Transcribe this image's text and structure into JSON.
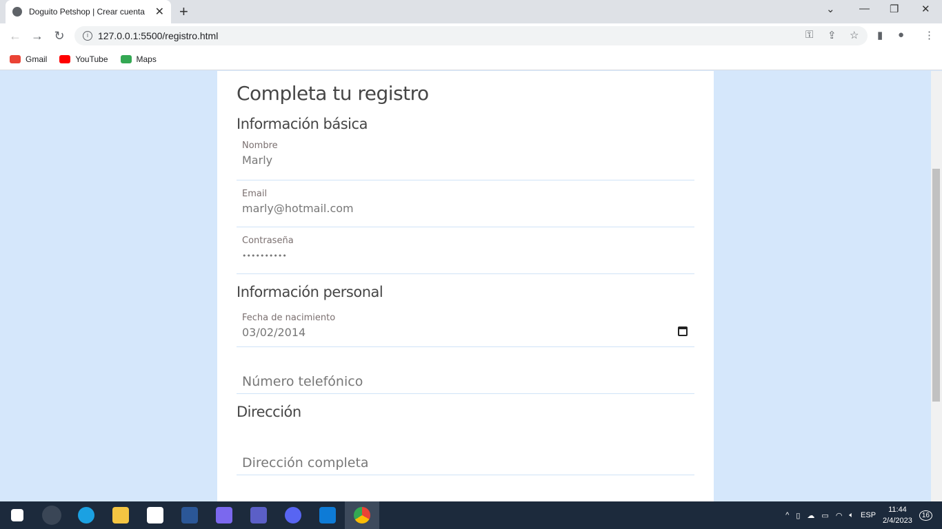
{
  "browser": {
    "tab_title": "Doguito Petshop | Crear cuenta",
    "url": "127.0.0.1:5500/registro.html",
    "bookmarks": [
      {
        "label": "Gmail",
        "color": "#ea4335"
      },
      {
        "label": "YouTube",
        "color": "#ff0000"
      },
      {
        "label": "Maps",
        "color": "#34a853"
      }
    ]
  },
  "form": {
    "title": "Completa tu registro",
    "sections": {
      "basic": "Información básica",
      "personal": "Información personal",
      "address": "Dirección"
    },
    "fields": {
      "nombre": {
        "label": "Nombre",
        "value": "Marly"
      },
      "email": {
        "label": "Email",
        "value": "marly@hotmail.com"
      },
      "password": {
        "label": "Contraseña",
        "value": "••••••••••"
      },
      "birth": {
        "label": "Fecha de nacimiento",
        "value": "03/02/2014"
      },
      "phone": {
        "placeholder": "Número telefónico"
      },
      "address": {
        "placeholder": "Dirección completa"
      }
    }
  },
  "taskbar": {
    "apps": [
      "start",
      "search",
      "edge",
      "file-explorer",
      "store",
      "word",
      "power-automate",
      "teams",
      "discord",
      "vscode",
      "chrome"
    ],
    "language": "ESP",
    "time": "11:44",
    "date": "2/4/2023",
    "notifications": "16"
  },
  "colors": {
    "page_bg": "#d5e7fb",
    "taskbar": "#1c2a3c"
  }
}
